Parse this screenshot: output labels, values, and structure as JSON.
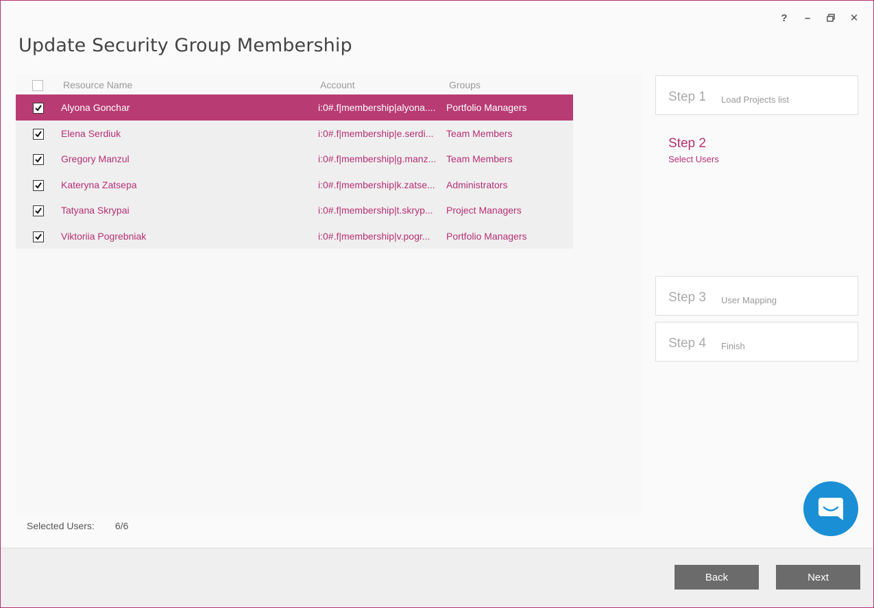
{
  "window": {
    "title": "Update Security Group Membership",
    "controls": {
      "help": "?",
      "minimize": "–",
      "restore": "⧉",
      "close": "✕"
    }
  },
  "grid": {
    "columns": {
      "name": "Resource Name",
      "account": "Account",
      "groups": "Groups"
    },
    "rows": [
      {
        "checked": true,
        "name": "Alyona Gonchar",
        "account": "i:0#.f|membership|alyona....",
        "group": "Portfolio Managers",
        "selected": true
      },
      {
        "checked": true,
        "name": "Elena Serdiuk",
        "account": "i:0#.f|membership|e.serdi...",
        "group": "Team Members"
      },
      {
        "checked": true,
        "name": "Gregory Manzul",
        "account": "i:0#.f|membership|g.manz...",
        "group": "Team Members"
      },
      {
        "checked": true,
        "name": "Kateryna Zatsepa",
        "account": "i:0#.f|membership|k.zatse...",
        "group": "Administrators"
      },
      {
        "checked": true,
        "name": "Tatyana Skrypai",
        "account": "i:0#.f|membership|t.skryp...",
        "group": "Project Managers"
      },
      {
        "checked": true,
        "name": "Viktoriia Pogrebniak",
        "account": "i:0#.f|membership|v.pogr...",
        "group": "Portfolio Managers"
      }
    ]
  },
  "footer": {
    "selected_label": "Selected Users:",
    "selected_value": "6/6"
  },
  "steps": [
    {
      "num": "Step 1",
      "desc": "Load Projects list"
    },
    {
      "num": "Step 2",
      "desc": "Select Users",
      "active": true
    },
    {
      "num": "Step 3",
      "desc": "User Mapping"
    },
    {
      "num": "Step 4",
      "desc": "Finish"
    }
  ],
  "buttons": {
    "back": "Back",
    "next": "Next"
  },
  "colors": {
    "accent": "#b52f73",
    "selected_row": "#b83b74",
    "button": "#6b6b6b",
    "chat": "#1a8fd6"
  }
}
